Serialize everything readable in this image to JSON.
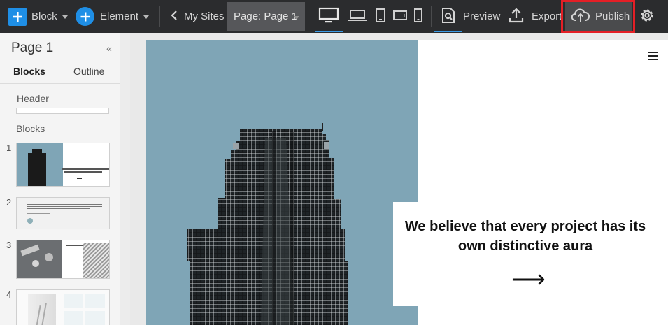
{
  "toolbar": {
    "block_label": "Block",
    "element_label": "Element",
    "my_sites_label": "My Sites",
    "page_select_label": "Page: Page 1",
    "preview_label": "Preview",
    "export_label": "Export",
    "publish_label": "Publish"
  },
  "colors": {
    "toolbar_bg": "#2b2c2e",
    "accent_blue": "#1f8fe6",
    "highlight_red": "#e41f26",
    "photo_bg": "#7fa5b6"
  },
  "left_panel": {
    "title": "Page 1",
    "tabs": [
      {
        "label": "Blocks",
        "active": true
      },
      {
        "label": "Outline",
        "active": false
      }
    ],
    "header_section": "Header",
    "blocks_section": "Blocks",
    "thumbnails": [
      {
        "number": "1"
      },
      {
        "number": "2"
      },
      {
        "number": "3"
      },
      {
        "number": "4"
      }
    ]
  },
  "canvas": {
    "quote": "We believe that every project has its own distinctive aura",
    "arrow": "⟶"
  }
}
